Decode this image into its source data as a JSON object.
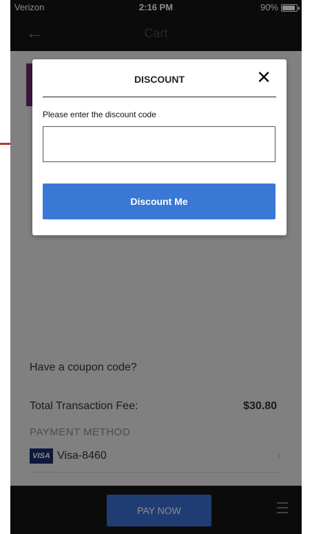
{
  "status_bar": {
    "carrier": "Verizon",
    "time": "2:16 PM",
    "battery": "90%",
    "battery_level": 0.9
  },
  "nav": {
    "back_icon": "arrow-left-icon",
    "title": "Cart"
  },
  "cart": {
    "coupon_link": "Have a coupon code?",
    "fee_label": "Total Transaction Fee:",
    "fee_value": "$30.80",
    "payment_method_label": "PAYMENT METHOD",
    "card_brand": "VISA",
    "card_label": "Visa-8460"
  },
  "bottom_bar": {
    "pay_button": "PAY NOW",
    "menu_icon": "hamburger-menu-icon"
  },
  "modal": {
    "title": "DISCOUNT",
    "close_glyph": "✕",
    "prompt": "Please enter the discount code",
    "input_value": "",
    "input_placeholder": "",
    "submit_label": "Discount Me"
  },
  "colors": {
    "accent": "#3a78d5",
    "annotation_arrow": "#b8382f",
    "bar_background": "#141414"
  }
}
